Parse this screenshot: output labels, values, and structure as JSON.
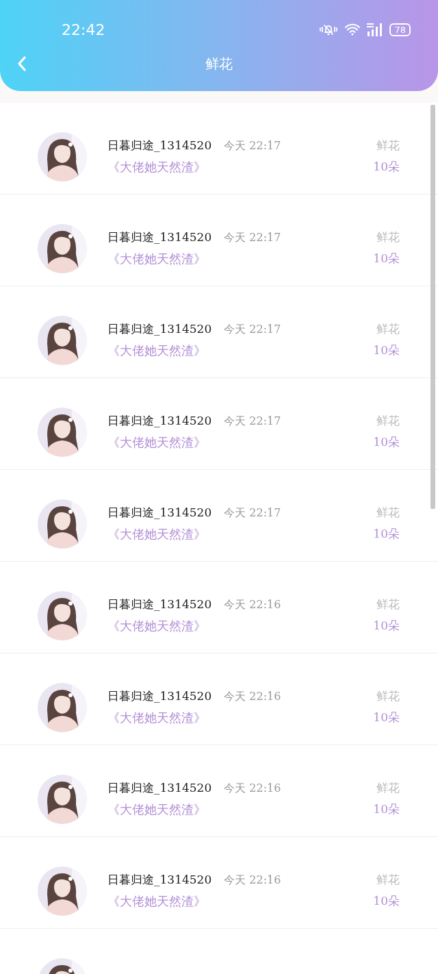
{
  "status_bar": {
    "time": "22:42",
    "battery": "78"
  },
  "header": {
    "title": "鲜花"
  },
  "items": [
    {
      "kind": "full",
      "name": "日暮归途_1314520",
      "time": "今天 22:17",
      "book": "《大佬她天然渣》",
      "gift": "鲜花",
      "amount": "10朵"
    },
    {
      "kind": "full",
      "name": "日暮归途_1314520",
      "time": "今天 22:17",
      "book": "《大佬她天然渣》",
      "gift": "鲜花",
      "amount": "10朵"
    },
    {
      "kind": "full",
      "name": "日暮归途_1314520",
      "time": "今天 22:17",
      "book": "《大佬她天然渣》",
      "gift": "鲜花",
      "amount": "10朵"
    },
    {
      "kind": "full",
      "name": "日暮归途_1314520",
      "time": "今天 22:17",
      "book": "《大佬她天然渣》",
      "gift": "鲜花",
      "amount": "10朵"
    },
    {
      "kind": "full",
      "name": "日暮归途_1314520",
      "time": "今天 22:17",
      "book": "《大佬她天然渣》",
      "gift": "鲜花",
      "amount": "10朵"
    },
    {
      "kind": "full",
      "name": "日暮归途_1314520",
      "time": "今天 22:16",
      "book": "《大佬她天然渣》",
      "gift": "鲜花",
      "amount": "10朵"
    },
    {
      "kind": "full",
      "name": "日暮归途_1314520",
      "time": "今天 22:16",
      "book": "《大佬她天然渣》",
      "gift": "鲜花",
      "amount": "10朵"
    },
    {
      "kind": "full",
      "name": "日暮归途_1314520",
      "time": "今天 22:16",
      "book": "《大佬她天然渣》",
      "gift": "鲜花",
      "amount": "10朵"
    },
    {
      "kind": "full",
      "name": "日暮归途_1314520",
      "time": "今天 22:16",
      "book": "《大佬她天然渣》",
      "gift": "鲜花",
      "amount": "10朵"
    },
    {
      "kind": "partial"
    }
  ]
}
